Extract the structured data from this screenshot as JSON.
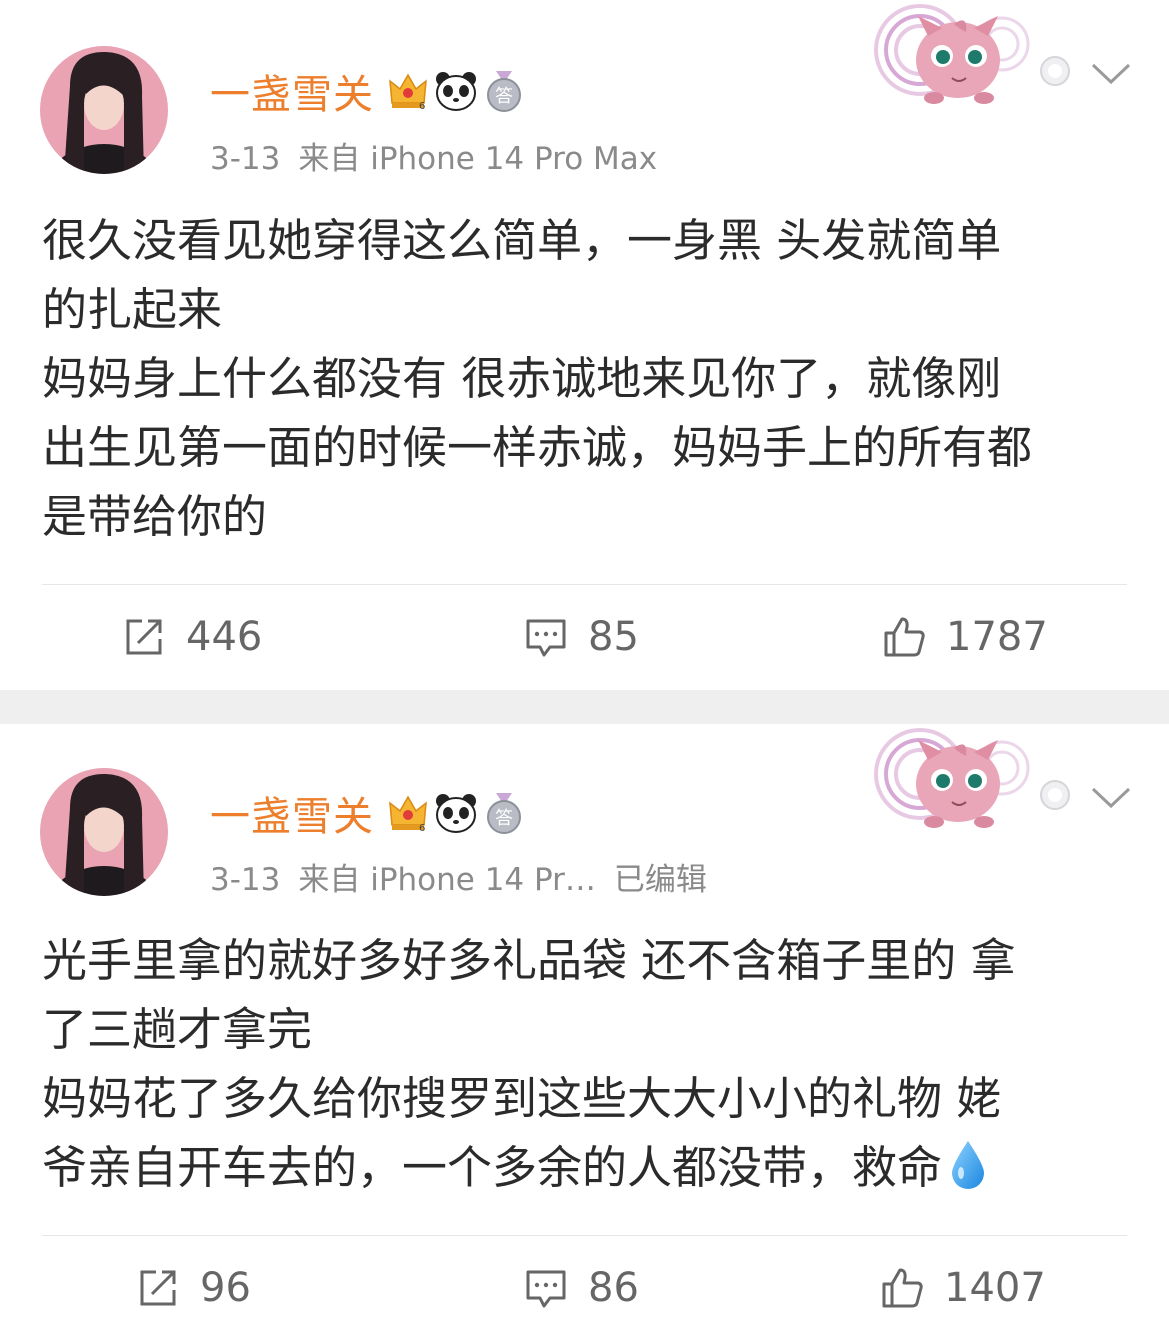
{
  "posts": [
    {
      "username": "一盏雪关",
      "meta": {
        "date": "3-13",
        "source": "来自 iPhone 14 Pro Max",
        "edited": ""
      },
      "content_lines": [
        "很久没看见她穿得这么简单，一身黑 头发就简单",
        "的扎起来",
        "妈妈身上什么都没有 很赤诚地来见你了，就像刚",
        "出生见第一面的时候一样赤诚，妈妈手上的所有都",
        "是带给你的"
      ],
      "stats": {
        "reposts": "446",
        "comments": "85",
        "likes": "1787"
      }
    },
    {
      "username": "一盏雪关",
      "meta": {
        "date": "3-13",
        "source": "来自 iPhone 14 Pr…",
        "edited": "已编辑"
      },
      "content_lines": [
        "光手里拿的就好多好多礼品袋 还不含箱子里的 拿",
        "了三趟才拿完",
        "妈妈花了多久给你搜罗到这些大大小小的礼物 姥",
        "爷亲自开车去的，一个多余的人都没带，救命"
      ],
      "stats": {
        "reposts": "96",
        "comments": "86",
        "likes": "1407"
      }
    }
  ],
  "icons": [
    "crown-badge-icon",
    "panda-badge-icon",
    "medal-badge-icon",
    "jigglypuff-decoration-icon",
    "more-dot-icon",
    "chevron-down-icon",
    "repost-icon",
    "comment-icon",
    "like-icon",
    "water-drop-emoji-icon"
  ],
  "colors": {
    "username": "#ec7e2c",
    "meta": "#8a8a8a",
    "text": "#2b2b2b",
    "separator": "#efefef"
  }
}
